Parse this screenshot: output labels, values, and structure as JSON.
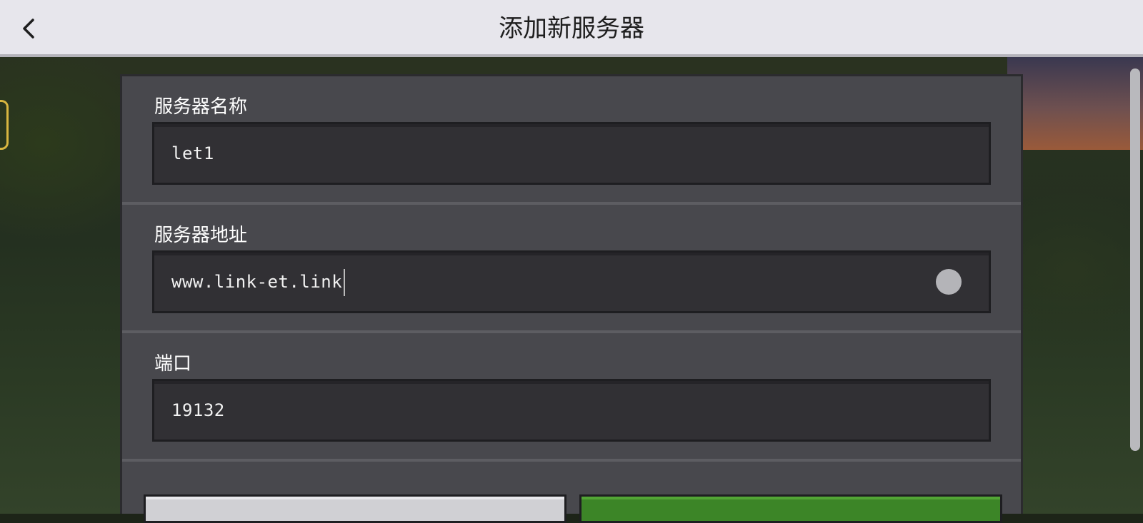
{
  "header": {
    "title": "添加新服务器",
    "back_icon": "chevron-left-icon"
  },
  "form": {
    "server_name": {
      "label": "服务器名称",
      "value": "let1"
    },
    "server_address": {
      "label": "服务器地址",
      "value": "www.link-et.link",
      "clear_icon": "clear-circle-icon"
    },
    "port": {
      "label": "端口",
      "value": "19132"
    }
  },
  "buttons": {
    "cancel_label": "",
    "save_label": ""
  },
  "colors": {
    "header_bg": "#e7e6ec",
    "panel_bg": "#48484d",
    "field_bg": "#313034",
    "save_green": "#3c8527",
    "cancel_gray": "#d0d0d4"
  }
}
